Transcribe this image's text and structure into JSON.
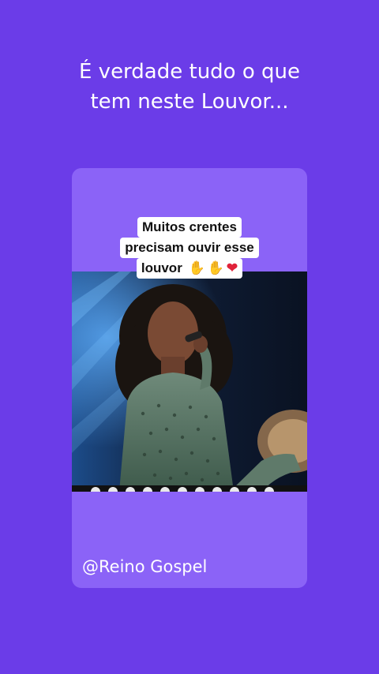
{
  "headline": {
    "line1": "É verdade tudo o que",
    "line2": "tem neste Louvor..."
  },
  "caption": {
    "line1": "Muitos crentes",
    "line2": "precisam ouvir esse",
    "line3": "louvor",
    "emojis": [
      "raising-hands-icon",
      "praying-hands-icon",
      "red-heart-icon"
    ]
  },
  "handle": "@Reino Gospel",
  "colors": {
    "background": "#6b3ce8",
    "card": "#8b63f7",
    "text": "#ffffff"
  }
}
